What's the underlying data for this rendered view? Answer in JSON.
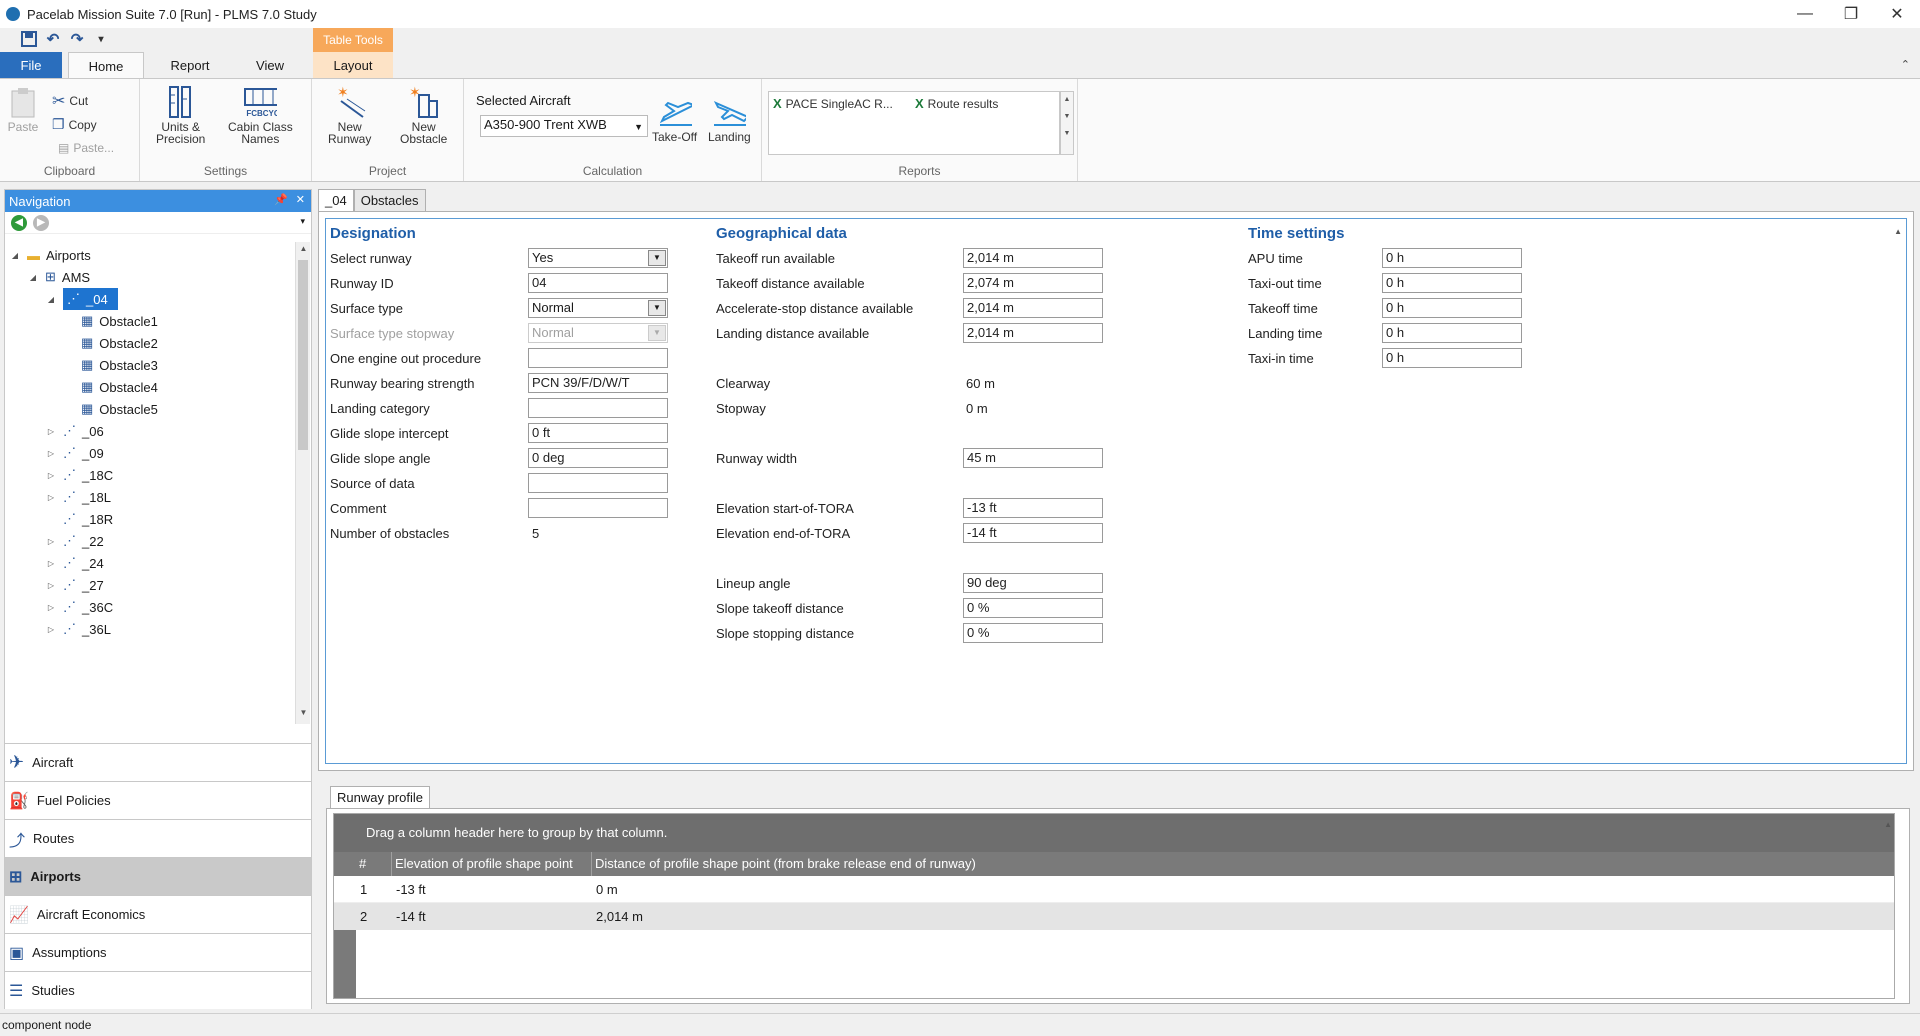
{
  "window": {
    "title": "Pacelab Mission Suite 7.0 [Run] - PLMS 7.0 Study",
    "min": "—",
    "max": "❐",
    "close": "✕"
  },
  "ribbon": {
    "contextual_title": "Table Tools",
    "tabs": {
      "file": "File",
      "home": "Home",
      "report": "Report",
      "view": "View",
      "layout": "Layout"
    },
    "clipboard": {
      "label": "Clipboard",
      "paste": "Paste",
      "cut": "Cut",
      "copy": "Copy",
      "paste_special": "Paste..."
    },
    "settings": {
      "label": "Settings",
      "units": "Units &\nPrecision",
      "cabin": "Cabin Class\nNames",
      "cabin_icon_text": "FCBCYC"
    },
    "project": {
      "label": "Project",
      "new_runway": "New\nRunway",
      "new_obstacle": "New\nObstacle"
    },
    "calculation": {
      "label": "Calculation",
      "selected_aircraft_label": "Selected Aircraft",
      "selected_aircraft": "A350-900 Trent XWB",
      "takeoff": "Take-Off",
      "landing": "Landing"
    },
    "reports": {
      "label": "Reports",
      "items": [
        "PACE SingleAC R...",
        "Route results"
      ]
    }
  },
  "nav": {
    "title": "Navigation",
    "tree": {
      "airports": "Airports",
      "ams": "AMS",
      "selected_runway": "_04",
      "obstacles": [
        "Obstacle1",
        "Obstacle2",
        "Obstacle3",
        "Obstacle4",
        "Obstacle5"
      ],
      "runways": [
        "_06",
        "_09",
        "_18C",
        "_18L",
        "_18R",
        "_22",
        "_24",
        "_27",
        "_36C",
        "_36L"
      ]
    },
    "sections": [
      "Aircraft",
      "Fuel Policies",
      "Routes",
      "Airports",
      "Aircraft Economics",
      "Assumptions",
      "Studies"
    ],
    "active_section": "Airports"
  },
  "doc": {
    "tabs": [
      "_04",
      "Obstacles"
    ],
    "designation": {
      "title": "Designation",
      "select_runway": {
        "label": "Select runway",
        "value": "Yes"
      },
      "runway_id": {
        "label": "Runway ID",
        "value": "04"
      },
      "surface_type": {
        "label": "Surface type",
        "value": "Normal"
      },
      "surface_type_stopway": {
        "label": "Surface type stopway",
        "value": "Normal"
      },
      "one_engine_out": {
        "label": "One engine out procedure",
        "value": ""
      },
      "bearing_strength": {
        "label": "Runway bearing strength",
        "value": "PCN 39/F/D/W/T"
      },
      "landing_category": {
        "label": "Landing category",
        "value": ""
      },
      "glide_intercept": {
        "label": "Glide slope intercept",
        "value": "0 ft"
      },
      "glide_angle": {
        "label": "Glide slope angle",
        "value": "0 deg"
      },
      "source_of_data": {
        "label": "Source of data",
        "value": ""
      },
      "comment": {
        "label": "Comment",
        "value": ""
      },
      "num_obstacles": {
        "label": "Number of obstacles",
        "value": "5"
      }
    },
    "geo": {
      "title": "Geographical data",
      "tora": {
        "label": "Takeoff run available",
        "value": "2,014 m"
      },
      "toda": {
        "label": "Takeoff distance available",
        "value": "2,074 m"
      },
      "asda": {
        "label": "Accelerate-stop distance available",
        "value": "2,014 m"
      },
      "lda": {
        "label": "Landing distance available",
        "value": "2,014 m"
      },
      "clearway": {
        "label": "Clearway",
        "value": "60 m"
      },
      "stopway": {
        "label": "Stopway",
        "value": "0 m"
      },
      "width": {
        "label": "Runway width",
        "value": "45 m"
      },
      "elev_start": {
        "label": "Elevation start-of-TORA",
        "value": "-13 ft"
      },
      "elev_end": {
        "label": "Elevation end-of-TORA",
        "value": "-14 ft"
      },
      "lineup": {
        "label": "Lineup angle",
        "value": "90 deg"
      },
      "slope_to": {
        "label": "Slope takeoff distance",
        "value": "0 %"
      },
      "slope_stop": {
        "label": "Slope stopping distance",
        "value": "0 %"
      }
    },
    "time": {
      "title": "Time settings",
      "apu": {
        "label": "APU time",
        "value": "0 h"
      },
      "taxi_out": {
        "label": "Taxi-out time",
        "value": "0 h"
      },
      "takeoff": {
        "label": "Takeoff time",
        "value": "0 h"
      },
      "landing": {
        "label": "Landing time",
        "value": "0 h"
      },
      "taxi_in": {
        "label": "Taxi-in time",
        "value": "0 h"
      }
    }
  },
  "profile": {
    "tab": "Runway profile",
    "group_hint": "Drag a column header here to group by that column.",
    "columns": [
      "#",
      "Elevation of profile shape point",
      "Distance of profile shape point (from brake release end of runway)"
    ],
    "rows": [
      {
        "n": "1",
        "elev": "-13 ft",
        "dist": "0 m"
      },
      {
        "n": "2",
        "elev": "-14 ft",
        "dist": "2,014 m"
      }
    ]
  },
  "status": "component node",
  "colors": {
    "accent": "#2a6ebd",
    "selection": "#1e74d0",
    "header": "#1f5ea8",
    "contextual": "#f7a85a"
  }
}
